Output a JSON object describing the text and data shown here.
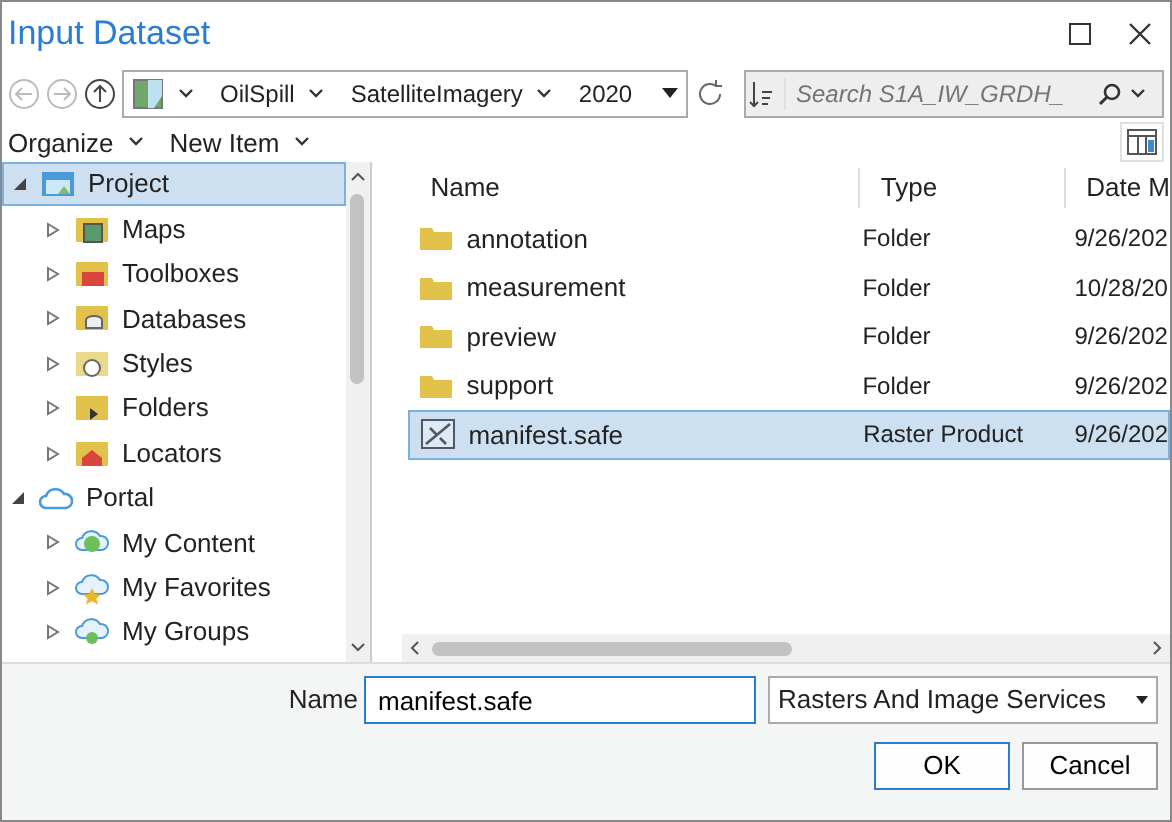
{
  "window": {
    "title": "Input Dataset"
  },
  "breadcrumb": [
    "OilSpill",
    "SatelliteImagery",
    "2020"
  ],
  "search": {
    "placeholder": "Search S1A_IW_GRDH_"
  },
  "toolbar": [
    "Organize",
    "New Item"
  ],
  "tree": [
    {
      "label": "Project",
      "kind": "project",
      "expanded": true,
      "selected": true,
      "children": [
        {
          "label": "Maps",
          "kind": "maps",
          "expanded": false,
          "selected": false
        },
        {
          "label": "Toolboxes",
          "kind": "toolboxes",
          "expanded": false,
          "selected": false
        },
        {
          "label": "Databases",
          "kind": "databases",
          "expanded": false,
          "selected": false
        },
        {
          "label": "Styles",
          "kind": "styles",
          "expanded": false,
          "selected": false
        },
        {
          "label": "Folders",
          "kind": "folders",
          "expanded": false,
          "selected": false
        },
        {
          "label": "Locators",
          "kind": "locators",
          "expanded": false,
          "selected": false
        }
      ]
    },
    {
      "label": "Portal",
      "kind": "portal",
      "expanded": true,
      "selected": false,
      "children": [
        {
          "label": "My Content",
          "kind": "content",
          "expanded": false,
          "selected": false
        },
        {
          "label": "My Favorites",
          "kind": "favorites",
          "expanded": false,
          "selected": false
        },
        {
          "label": "My Groups",
          "kind": "groups",
          "expanded": false,
          "selected": false
        }
      ]
    }
  ],
  "table": {
    "columns": [
      "Name",
      "Type",
      "Date M"
    ],
    "rows": [
      {
        "name": "annotation",
        "type": "Folder",
        "date": "9/26/202",
        "kind": "folder",
        "selected": false
      },
      {
        "name": "measurement",
        "type": "Folder",
        "date": "10/28/20",
        "kind": "folder",
        "selected": false
      },
      {
        "name": "preview",
        "type": "Folder",
        "date": "9/26/202",
        "kind": "folder",
        "selected": false
      },
      {
        "name": "support",
        "type": "Folder",
        "date": "9/26/202",
        "kind": "folder",
        "selected": false
      },
      {
        "name": "manifest.safe",
        "type": "Raster Product",
        "date": "9/26/202",
        "kind": "raster",
        "selected": true
      }
    ]
  },
  "name_field": {
    "label": "Name",
    "value": "manifest.safe"
  },
  "filter": {
    "value": "Rasters And Image Services"
  },
  "buttons": [
    {
      "label": "OK",
      "kind": "primary"
    },
    {
      "label": "Cancel",
      "kind": "secondary"
    }
  ]
}
